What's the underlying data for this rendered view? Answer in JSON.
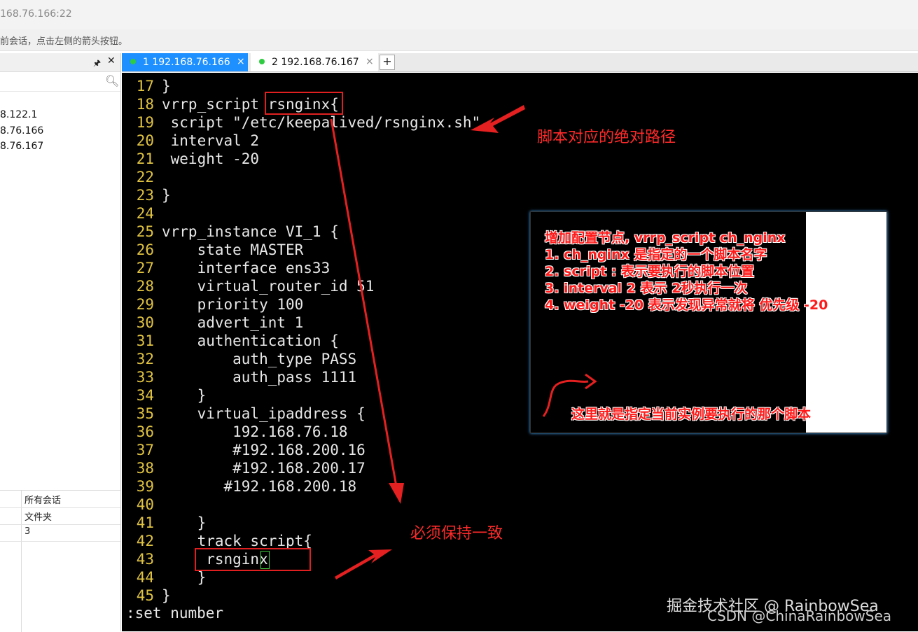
{
  "window": {
    "title": "168.76.166:22",
    "hint": "前会话，点击左侧的箭头按钮。"
  },
  "sidebar": {
    "pin_icon": "pin-icon",
    "close_icon": "close-icon",
    "search_icon": "search-icon",
    "sessions": [
      "8.122.1",
      "8.76.166",
      "8.76.167"
    ],
    "props": [
      {
        "value": "所有会话"
      },
      {
        "value": "文件夹"
      },
      {
        "value": "3"
      }
    ]
  },
  "tabs": [
    {
      "label": "1 192.168.76.166",
      "close": "×",
      "active": true
    },
    {
      "label": "2 192.168.76.167",
      "close": "×",
      "active": false
    }
  ],
  "tab_add": "+",
  "terminal": {
    "lines": [
      {
        "no": "17",
        "code": "}"
      },
      {
        "no": "18",
        "code": "vrrp_script rsnginx{"
      },
      {
        "no": "19",
        "code": " script \"/etc/keepalived/rsnginx.sh\""
      },
      {
        "no": "20",
        "code": " interval 2"
      },
      {
        "no": "21",
        "code": " weight -20"
      },
      {
        "no": "22",
        "code": ""
      },
      {
        "no": "23",
        "code": "}"
      },
      {
        "no": "24",
        "code": ""
      },
      {
        "no": "25",
        "code": "vrrp_instance VI_1 {"
      },
      {
        "no": "26",
        "code": "    state MASTER"
      },
      {
        "no": "27",
        "code": "    interface ens33"
      },
      {
        "no": "28",
        "code": "    virtual_router_id 51"
      },
      {
        "no": "29",
        "code": "    priority 100"
      },
      {
        "no": "30",
        "code": "    advert_int 1"
      },
      {
        "no": "31",
        "code": "    authentication {"
      },
      {
        "no": "32",
        "code": "        auth_type PASS"
      },
      {
        "no": "33",
        "code": "        auth_pass 1111"
      },
      {
        "no": "34",
        "code": "    }"
      },
      {
        "no": "35",
        "code": "    virtual_ipaddress {"
      },
      {
        "no": "36",
        "code": "        192.168.76.18"
      },
      {
        "no": "37",
        "code": "        #192.168.200.16"
      },
      {
        "no": "38",
        "code": "        #192.168.200.17"
      },
      {
        "no": "39",
        "code": "       #192.168.200.18"
      },
      {
        "no": "40",
        "code": ""
      },
      {
        "no": "41",
        "code": "    }"
      },
      {
        "no": "42",
        "code": "    track_script{"
      },
      {
        "no": "43",
        "code": "     rsnginx"
      },
      {
        "no": "44",
        "code": "    }"
      },
      {
        "no": "45",
        "code": "}"
      }
    ],
    "command": ":set number"
  },
  "annotations": {
    "path": "脚本对应的绝对路径",
    "consistent": "必须保持一致",
    "note_lines": [
      "增加配置节点, vrrp_script ch_nginx",
      "1. ch_nginx 是指定的一个脚本名字",
      "2. script : 表示要执行的脚本位置",
      "3. interval 2 表示 2秒执行一次",
      "4. weight -20 表示发现异常就将 优先级 -20"
    ],
    "note_bottom": "这里就是指定当前实例要执行的那个脚本"
  },
  "watermark": {
    "line1": "掘金技术社区 @ RainbowSea",
    "line2": "CSDN @ChinaRainbowSea"
  }
}
